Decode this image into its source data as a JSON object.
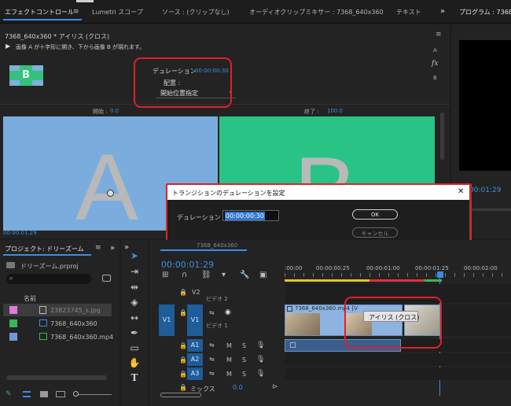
{
  "top_tabs": {
    "effect_controls": "エフェクトコントロール",
    "lumetri": "Lumetri スコープ",
    "source": "ソース : (クリップなし)",
    "audio_mixer": "オーディオクリップミキサー : 7368_640x360",
    "text": "テキスト",
    "program": "プログラム : 7368_"
  },
  "effect_controls": {
    "header": "7368_640x360 * アイリス (クロス)",
    "description": "画像 A が十字形に開き、下から画像 B が現れます。",
    "thumb_letter": "B",
    "side_a": "A",
    "side_b": "B",
    "duration_label": "デュレーション",
    "duration_value": "00:00:00:30",
    "alignment_label": "配置 :",
    "alignment_value": "開始位置指定",
    "fx_label": "fx",
    "start_label": "開始 :",
    "start_value": "0.0",
    "end_label": "終了 :",
    "end_value": "100.0",
    "preview_a_letter": "A",
    "preview_b_letter": "B",
    "bottom_timecode": "00:00:01:29"
  },
  "program": {
    "timecode": "00:01:29"
  },
  "dialog": {
    "title": "トランジションのデュレーションを設定",
    "duration_label": "デュレーション :",
    "duration_value": "00:00:00:30",
    "ok_label": "OK",
    "cancel_label": "キャンセル",
    "close_glyph": "✕"
  },
  "project": {
    "title": "プロジェクト: ドリーズーム",
    "file": "ドリーズーム.prproj",
    "column_name": "名前",
    "items": [
      {
        "name": "23823745_s.jpg",
        "color": "#e07ad8"
      },
      {
        "name": "7368_640x360",
        "color": "#3cb556"
      },
      {
        "name": "7368_640x360.mp4",
        "color": "#6f9ad8"
      }
    ]
  },
  "timeline": {
    "tab_label": "7368_640x360",
    "timecode": "00:00:01:29",
    "ruler": [
      ":00:00",
      "00:00:00:25",
      "00:00:01:00",
      "00:00:01:25",
      "00:00:02:00"
    ],
    "tracks": {
      "v2": "V2",
      "v2_name": "ビデオ 2",
      "v1_src": "V1",
      "v1": "V1",
      "v1_name": "ビデオ 1",
      "a1": "A1",
      "a2": "A2",
      "a3": "A3",
      "mix_label": "ミックス",
      "mix_value": "0.0",
      "m": "M",
      "s": "S"
    },
    "clip_label": "7368_640x360.mp4 [V",
    "transition_label": "アイリス (クロス)",
    "accent": "#3a8ee0"
  }
}
